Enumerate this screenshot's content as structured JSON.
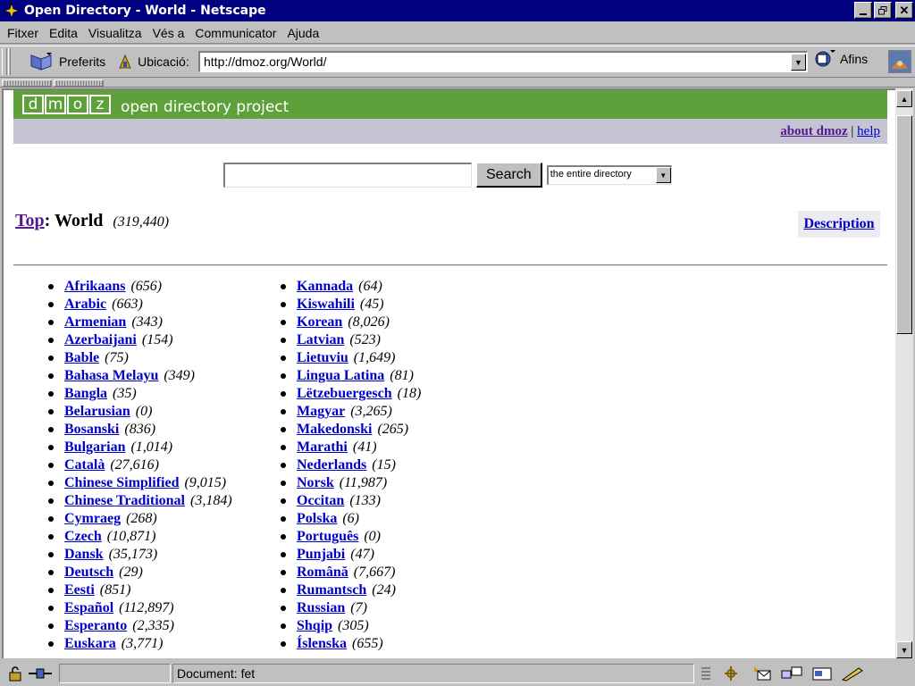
{
  "window": {
    "title": "Open Directory - World - Netscape"
  },
  "menu": [
    "Fitxer",
    "Edita",
    "Visualitza",
    "Vés a",
    "Communicator",
    "Ajuda"
  ],
  "toolbar": {
    "bookmarks_label": "Preferits",
    "location_label": "Ubicació:",
    "url": "http://dmoz.org/World/",
    "related_label": "Afins"
  },
  "banner": {
    "letters": [
      "d",
      "m",
      "o",
      "z"
    ],
    "tagline": "open directory project"
  },
  "header_links": {
    "about": "about dmoz",
    "separator": "|",
    "help": "help"
  },
  "search": {
    "query": "",
    "button_label": "Search",
    "scope": "the entire directory"
  },
  "breadcrumb": {
    "top": "Top",
    "separator": ":",
    "current": "World",
    "count": "(319,440)"
  },
  "description_link": "Description",
  "categories_left": [
    {
      "name": "Afrikaans",
      "count": "(656)"
    },
    {
      "name": "Arabic",
      "count": "(663)"
    },
    {
      "name": "Armenian",
      "count": "(343)"
    },
    {
      "name": "Azerbaijani",
      "count": "(154)"
    },
    {
      "name": "Bable",
      "count": "(75)"
    },
    {
      "name": "Bahasa Melayu",
      "count": "(349)"
    },
    {
      "name": "Bangla",
      "count": "(35)"
    },
    {
      "name": "Belarusian",
      "count": "(0)"
    },
    {
      "name": "Bosanski",
      "count": "(836)"
    },
    {
      "name": "Bulgarian",
      "count": "(1,014)"
    },
    {
      "name": "Català",
      "count": "(27,616)"
    },
    {
      "name": "Chinese Simplified",
      "count": "(9,015)"
    },
    {
      "name": "Chinese Traditional",
      "count": "(3,184)"
    },
    {
      "name": "Cymraeg",
      "count": "(268)"
    },
    {
      "name": "Czech",
      "count": "(10,871)"
    },
    {
      "name": "Dansk",
      "count": "(35,173)"
    },
    {
      "name": "Deutsch",
      "count": "(29)"
    },
    {
      "name": "Eesti",
      "count": "(851)"
    },
    {
      "name": "Español",
      "count": "(112,897)"
    },
    {
      "name": "Esperanto",
      "count": "(2,335)"
    },
    {
      "name": "Euskara",
      "count": "(3,771)"
    }
  ],
  "categories_right": [
    {
      "name": "Kannada",
      "count": "(64)"
    },
    {
      "name": "Kiswahili",
      "count": "(45)"
    },
    {
      "name": "Korean",
      "count": "(8,026)"
    },
    {
      "name": "Latvian",
      "count": "(523)"
    },
    {
      "name": "Lietuviu",
      "count": "(1,649)"
    },
    {
      "name": "Lingua Latina",
      "count": "(81)"
    },
    {
      "name": "Lëtzebuergesch",
      "count": "(18)"
    },
    {
      "name": "Magyar",
      "count": "(3,265)"
    },
    {
      "name": "Makedonski",
      "count": "(265)"
    },
    {
      "name": "Marathi",
      "count": "(41)"
    },
    {
      "name": "Nederlands",
      "count": "(15)"
    },
    {
      "name": "Norsk",
      "count": "(11,987)"
    },
    {
      "name": "Occitan",
      "count": "(133)"
    },
    {
      "name": "Polska",
      "count": "(6)"
    },
    {
      "name": "Português",
      "count": "(0)"
    },
    {
      "name": "Punjabi",
      "count": "(47)"
    },
    {
      "name": "Română",
      "count": "(7,667)"
    },
    {
      "name": "Rumantsch",
      "count": "(24)"
    },
    {
      "name": "Russian",
      "count": "(7)"
    },
    {
      "name": "Shqip",
      "count": "(305)"
    },
    {
      "name": "Íslenska",
      "count": "(655)"
    }
  ],
  "status": {
    "text": "Document: fet"
  }
}
